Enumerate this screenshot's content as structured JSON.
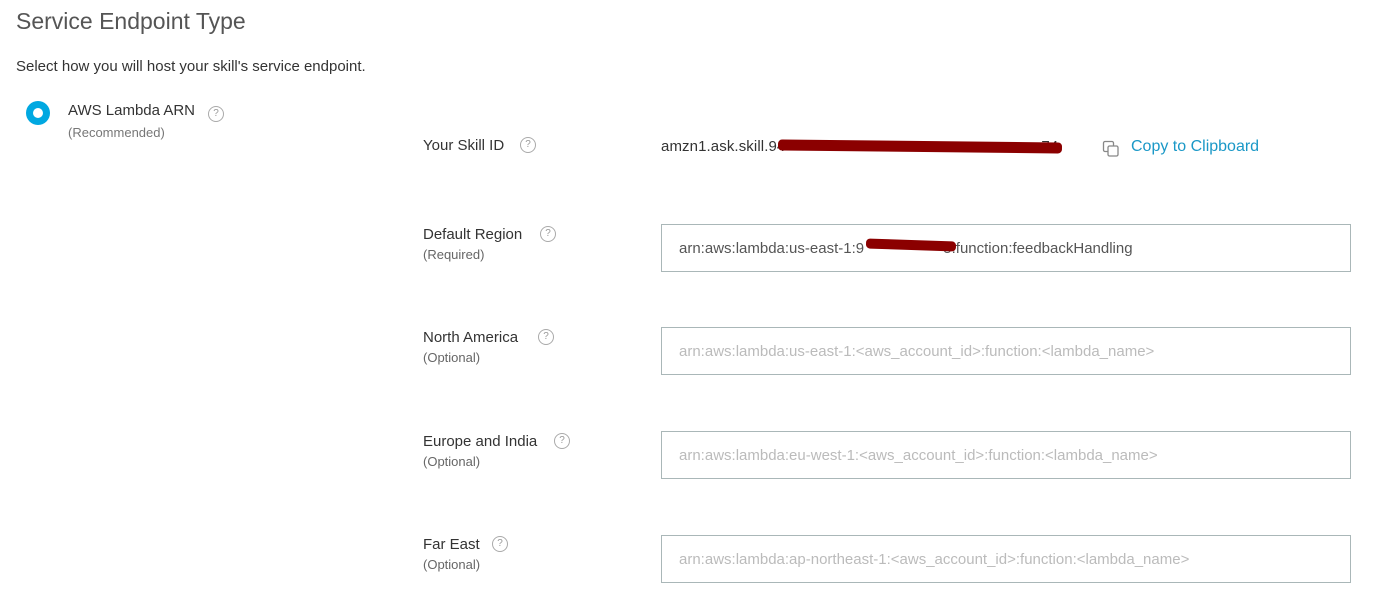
{
  "header": {
    "title": "Service Endpoint Type",
    "subtitle": "Select how you will host your skill's service endpoint."
  },
  "endpoint_option": {
    "label": "AWS Lambda ARN",
    "sublabel": "(Recommended)",
    "selected": true,
    "help_glyph": "?"
  },
  "skill_id": {
    "label": "Your Skill ID",
    "value": "amzn1.ask.skill.94                                                            74",
    "copy_label": "Copy to Clipboard",
    "help_glyph": "?"
  },
  "regions": [
    {
      "label": "Default Region",
      "sublabel": "(Required)",
      "value": "arn:aws:lambda:us-east-1:9                   5:function:feedbackHandling",
      "placeholder": "",
      "help_glyph": "?"
    },
    {
      "label": "North America",
      "sublabel": "(Optional)",
      "value": "",
      "placeholder": "arn:aws:lambda:us-east-1:<aws_account_id>:function:<lambda_name>",
      "help_glyph": "?"
    },
    {
      "label": "Europe and India",
      "sublabel": "(Optional)",
      "value": "",
      "placeholder": "arn:aws:lambda:eu-west-1:<aws_account_id>:function:<lambda_name>",
      "help_glyph": "?"
    },
    {
      "label": "Far East",
      "sublabel": "(Optional)",
      "value": "",
      "placeholder": "arn:aws:lambda:ap-northeast-1:<aws_account_id>:function:<lambda_name>",
      "help_glyph": "?"
    }
  ],
  "colors": {
    "accent": "#00a8e1",
    "link": "#1a98c7",
    "redaction": "#8b0000",
    "input_border": "#aab7b8"
  }
}
